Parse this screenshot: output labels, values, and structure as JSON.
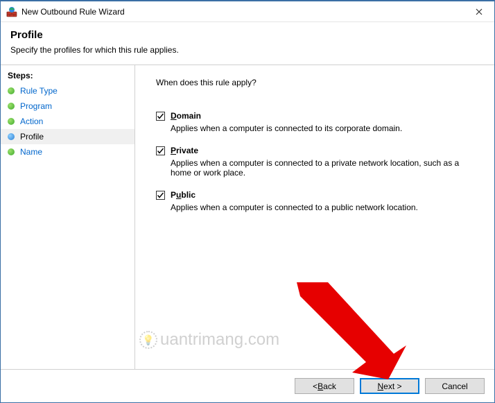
{
  "window": {
    "title": "New Outbound Rule Wizard"
  },
  "header": {
    "heading": "Profile",
    "subheading": "Specify the profiles for which this rule applies."
  },
  "sidebar": {
    "label": "Steps:",
    "items": [
      {
        "label": "Rule Type",
        "current": false
      },
      {
        "label": "Program",
        "current": false
      },
      {
        "label": "Action",
        "current": false
      },
      {
        "label": "Profile",
        "current": true
      },
      {
        "label": "Name",
        "current": false
      }
    ]
  },
  "content": {
    "question": "When does this rule apply?",
    "options": [
      {
        "checked": true,
        "label_pre": "",
        "label_ul": "D",
        "label_post": "omain",
        "desc": "Applies when a computer is connected to its corporate domain."
      },
      {
        "checked": true,
        "label_pre": "",
        "label_ul": "P",
        "label_post": "rivate",
        "desc": "Applies when a computer is connected to a private network location, such as a home or work place."
      },
      {
        "checked": true,
        "label_pre": "P",
        "label_ul": "u",
        "label_post": "blic",
        "desc": "Applies when a computer is connected to a public network location."
      }
    ]
  },
  "footer": {
    "back": {
      "pre": "< ",
      "ul": "B",
      "post": "ack"
    },
    "next": {
      "pre": "",
      "ul": "N",
      "post": "ext >"
    },
    "cancel": "Cancel"
  },
  "watermark": "uantrimang.com"
}
